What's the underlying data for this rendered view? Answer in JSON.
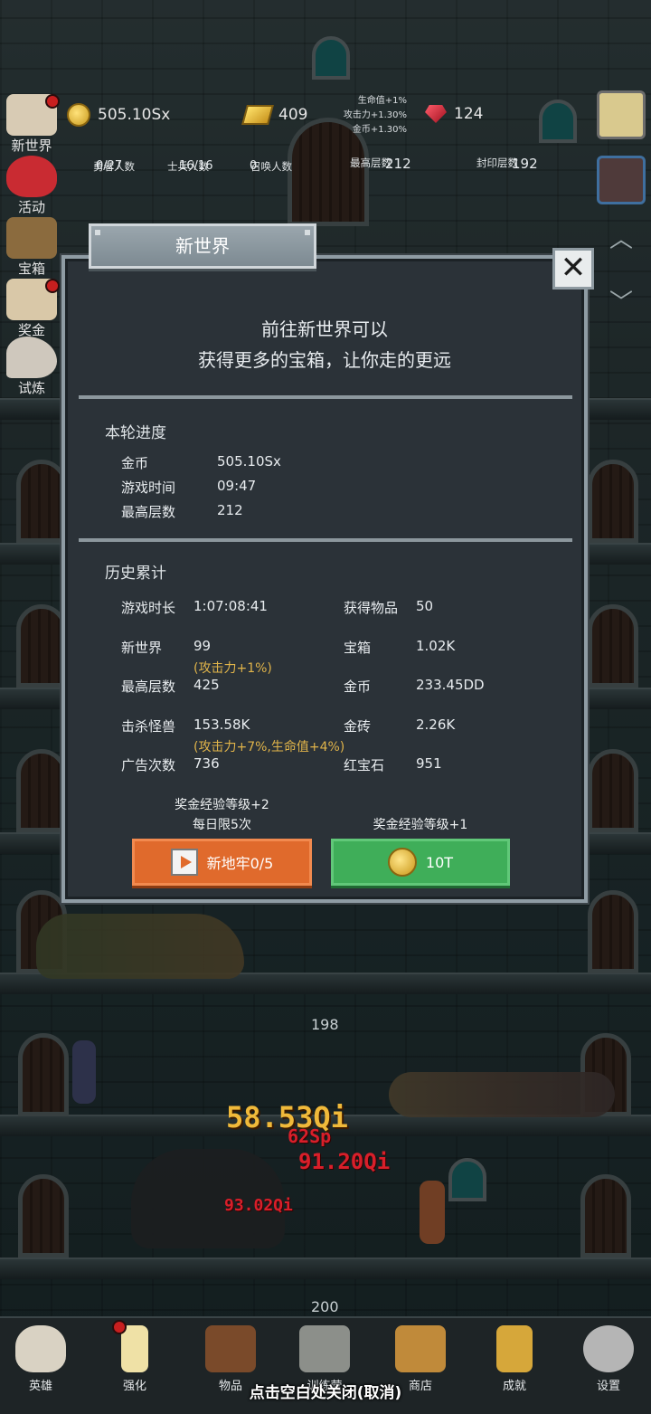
{
  "hud": {
    "gold": "505.10Sx",
    "gold_bars": "409",
    "rubies": "124",
    "bonus_lines": [
      "生命值+1%",
      "攻击力+1.30%",
      "金币+1.30%"
    ]
  },
  "stats": [
    {
      "value": "0/27",
      "label": "勇者人数"
    },
    {
      "value": "16/16",
      "label": "士兵人数"
    },
    {
      "value": "0",
      "label": "召唤人数"
    },
    {
      "value": "212",
      "label": "最高层数"
    },
    {
      "value": "192",
      "label": "封印层数"
    }
  ],
  "side_menu": [
    {
      "label": "新世界",
      "icon": "scroll-icon",
      "badge": true
    },
    {
      "label": "活动",
      "icon": "heart-icon",
      "badge": false
    },
    {
      "label": "宝箱",
      "icon": "chest-icon",
      "badge": false
    },
    {
      "label": "奖金",
      "icon": "letter-icon",
      "badge": true
    },
    {
      "label": "试炼",
      "icon": "feather-icon",
      "badge": false
    }
  ],
  "modal": {
    "title": "新世界",
    "headline_1": "前往新世界可以",
    "headline_2": "获得更多的宝箱，让你走的更远",
    "round_progress": {
      "title": "本轮进度",
      "rows": [
        {
          "key": "金币",
          "value": "505.10Sx"
        },
        {
          "key": "游戏时间",
          "value": "09:47"
        },
        {
          "key": "最高层数",
          "value": "212"
        }
      ]
    },
    "history": {
      "title": "历史累计",
      "rows": [
        {
          "key": "游戏时长",
          "value": "1:07:08:41"
        },
        {
          "key": "获得物品",
          "value": "50"
        },
        {
          "key": "新世界",
          "value": "99"
        },
        {
          "key": "宝箱",
          "value": "1.02K"
        },
        {
          "key": "最高层数",
          "value": "425"
        },
        {
          "key": "金币",
          "value": "233.45DD"
        },
        {
          "key": "击杀怪兽",
          "value": "153.58K"
        },
        {
          "key": "金砖",
          "value": "2.26K"
        },
        {
          "key": "广告次数",
          "value": "736"
        },
        {
          "key": "红宝石",
          "value": "951"
        }
      ],
      "note_new_world": "(攻击力+1%)",
      "note_kills": "(攻击力+7%,生命值+4%)"
    },
    "offer_video_line1": "奖金经验等级+2",
    "offer_video_line2": "每日限5次",
    "offer_coin_line": "奖金经验等级+1",
    "btn_video": "新地牢0/5",
    "btn_coin": "10T"
  },
  "floors": {
    "upper": "198",
    "lower": "200"
  },
  "damage": [
    "58.53Qi",
    "91.20Qi",
    "93.02Qi",
    "62Sp"
  ],
  "nav": [
    {
      "label": "英雄",
      "icon": "skull-icon"
    },
    {
      "label": "强化",
      "icon": "candle-icon"
    },
    {
      "label": "物品",
      "icon": "book-icon"
    },
    {
      "label": "训练营",
      "icon": "lantern-icon"
    },
    {
      "label": "商店",
      "icon": "mug-icon"
    },
    {
      "label": "成就",
      "icon": "key-icon"
    },
    {
      "label": "设置",
      "icon": "gear-icon"
    }
  ],
  "toast": "点击空白处关闭(取消)"
}
